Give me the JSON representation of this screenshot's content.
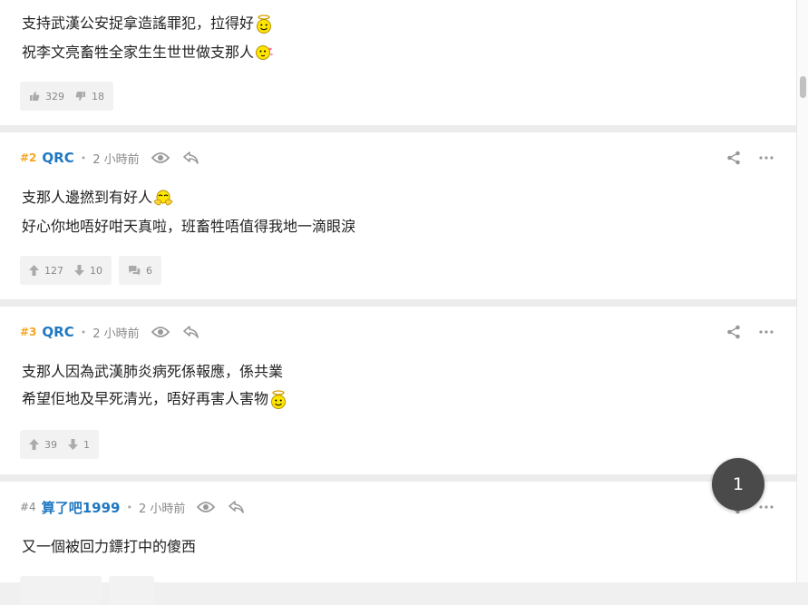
{
  "posts": [
    {
      "lines": [
        {
          "text": "支持武漢公安捉拿造謠罪犯，拉得好",
          "emoji": "angel-smiley-icon"
        },
        {
          "text": "祝李文亮畜牲全家生生世世做支那人",
          "emoji": "kiss-smiley-icon"
        }
      ],
      "likes": "329",
      "dislikes": "18"
    },
    {
      "floor": "#2",
      "username": "QRC",
      "time": "2 小時前",
      "lines": [
        {
          "text": "支那人邊撚到有好人",
          "emoji": "clapping-hands-smiley-icon"
        },
        {
          "text": "好心你地唔好咁天真啦，班畜牲唔值得我地一滴眼淚"
        }
      ],
      "likes": "127",
      "dislikes": "10",
      "replies": "6"
    },
    {
      "floor": "#3",
      "username": "QRC",
      "time": "2 小時前",
      "lines": [
        {
          "text": "支那人因為武漢肺炎病死係報應，係共業"
        },
        {
          "text": "希望佢地及早死清光，唔好再害人害物",
          "emoji": "angel-smiley-icon"
        }
      ],
      "likes": "39",
      "dislikes": "1"
    },
    {
      "floor": "#4",
      "username": "算了吧1999",
      "time": "2 小時前",
      "lines": [
        {
          "text": "又一個被回力鏢打中的傻西"
        }
      ]
    }
  ],
  "pagination": {
    "current_page": "1"
  },
  "colors": {
    "accent_floor": "#f5a623",
    "username": "#1f78c1",
    "bubble": "#4a4a4a"
  }
}
